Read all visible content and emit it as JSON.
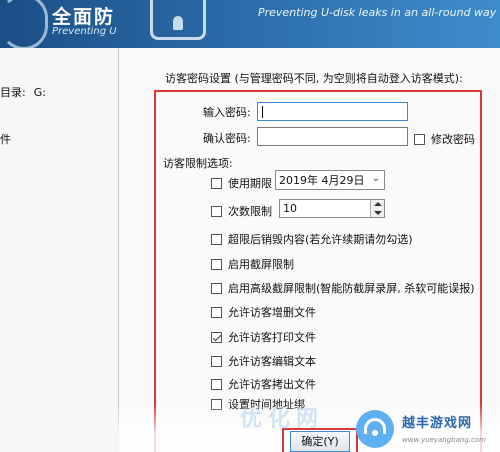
{
  "background": {
    "banner_title": "全面防",
    "banner_subtitle": "Preventing U",
    "banner_slogan": "Preventing U-disk leaks in an all-round way",
    "dir_label": "目录:",
    "dir_value": "G:",
    "file_label": "件"
  },
  "dialog": {
    "heading": "访客密码设置 (与管理密码不同, 为空则将自动登入访客模式):",
    "password_label": "输入密码:",
    "password_value": "",
    "confirm_label": "确认密码:",
    "confirm_value": "",
    "change_password_label": "修改密码",
    "change_password_checked": false,
    "options_label": "访客限制选项:",
    "expiry_label": "使用期限",
    "expiry_checked": false,
    "expiry_date": "2019年 4月29日",
    "count_label": "次数限制",
    "count_checked": false,
    "count_value": "10",
    "options": [
      {
        "label": "超限后销毁内容(若允许续期请勿勾选)",
        "checked": false
      },
      {
        "label": "启用截屏限制",
        "checked": false
      },
      {
        "label": "启用高级截屏限制(智能防截屏录屏, 杀软可能误报)",
        "checked": false
      },
      {
        "label": "允许访客增删文件",
        "checked": false
      },
      {
        "label": "允许访客打印文件",
        "checked": true
      },
      {
        "label": "允许访客编辑文本",
        "checked": false
      },
      {
        "label": "允许访客拷出文件",
        "checked": false
      },
      {
        "label": "设置时间地址绑",
        "checked": false
      }
    ],
    "ok_label": "确定(Y)"
  },
  "watermark": {
    "chars": "优化网",
    "name": "越丰游戏网",
    "url": "www.yueyangbang.com"
  },
  "colors": {
    "highlight": "#d9383a",
    "banner": "#2a6aa8",
    "focus": "#3b88d6"
  }
}
